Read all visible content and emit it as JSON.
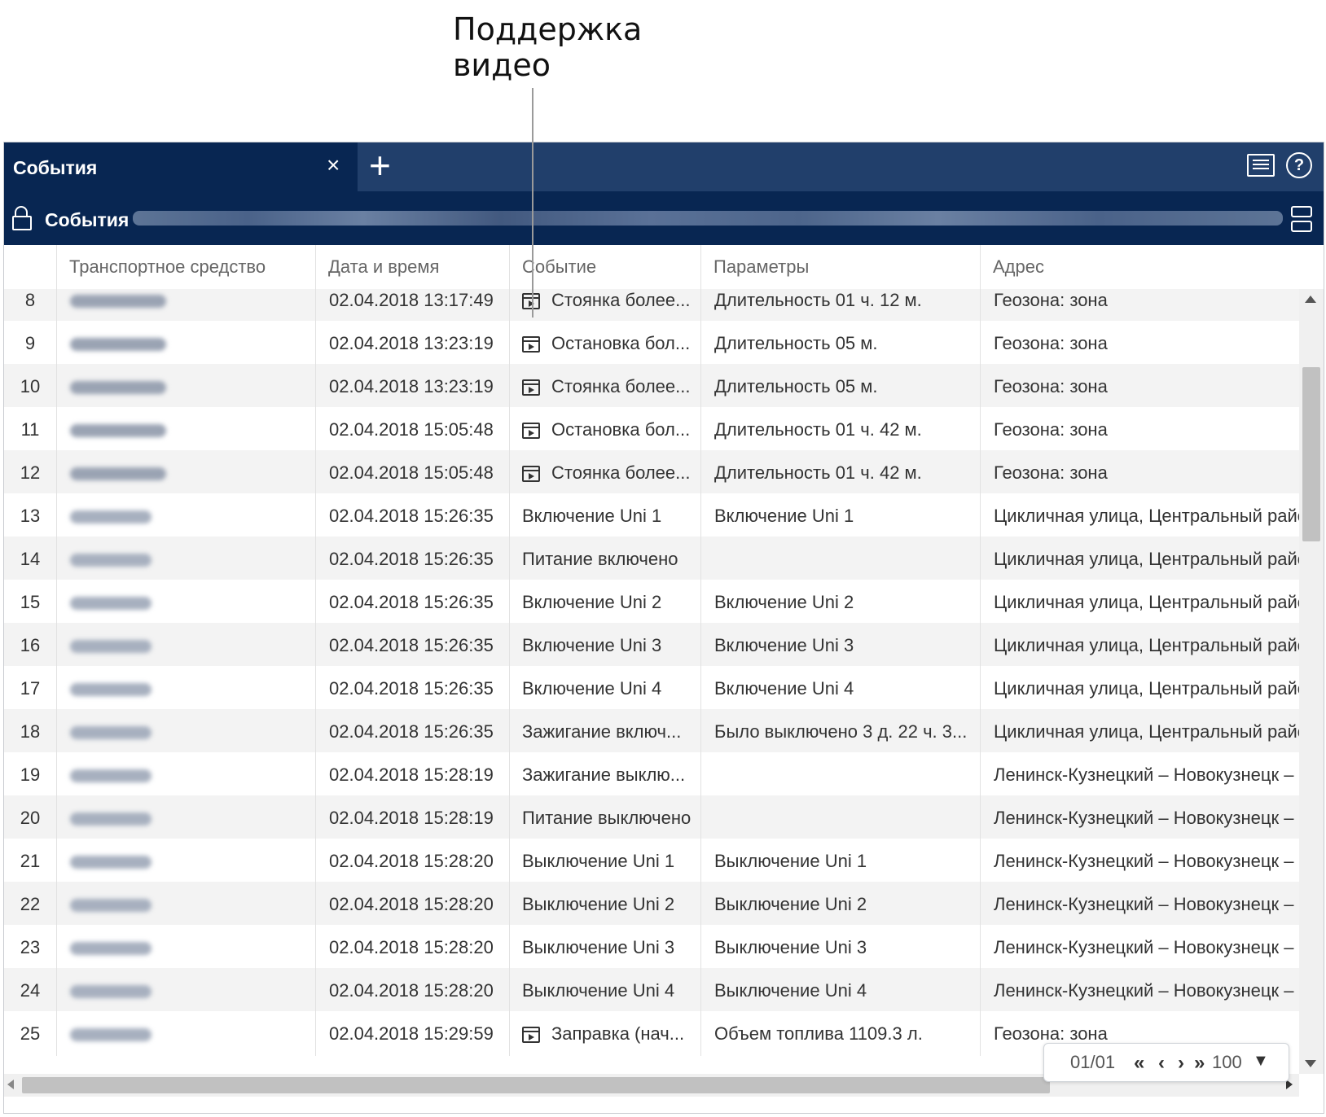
{
  "callout": {
    "line1": "Поддержка",
    "line2": "видео"
  },
  "tab": {
    "title": "События",
    "close": "×",
    "add": "+"
  },
  "icons": {
    "chat": "chat-icon",
    "help": "help-icon",
    "lock": "unlock-icon",
    "split": "split-view-icon",
    "video": "video-icon",
    "help_glyph": "?"
  },
  "subbar": {
    "title": "События"
  },
  "columns": {
    "vehicle": "Транспортное средство",
    "datetime": "Дата и время",
    "event": "Событие",
    "params": "Параметры",
    "address": "Адрес"
  },
  "rows": [
    {
      "num": "8",
      "date": "02.04.2018 13:17:49",
      "event": "Стоянка более...",
      "params": "Длительность 01 ч. 12 м.",
      "address": "Геозона: зона",
      "video": true
    },
    {
      "num": "9",
      "date": "02.04.2018 13:23:19",
      "event": "Остановка бол...",
      "params": "Длительность 05 м.",
      "address": "Геозона: зона",
      "video": true
    },
    {
      "num": "10",
      "date": "02.04.2018 13:23:19",
      "event": "Стоянка более...",
      "params": "Длительность 05 м.",
      "address": "Геозона: зона",
      "video": true
    },
    {
      "num": "11",
      "date": "02.04.2018 15:05:48",
      "event": "Остановка бол...",
      "params": "Длительность 01 ч. 42 м.",
      "address": "Геозона: зона",
      "video": true
    },
    {
      "num": "12",
      "date": "02.04.2018 15:05:48",
      "event": "Стоянка более...",
      "params": "Длительность 01 ч. 42 м.",
      "address": "Геозона: зона",
      "video": true
    },
    {
      "num": "13",
      "date": "02.04.2018 15:26:35",
      "event": "Включение Uni 1",
      "params": "Включение Uni 1",
      "address": "Цикличная улица, Центральный райо",
      "video": false
    },
    {
      "num": "14",
      "date": "02.04.2018 15:26:35",
      "event": "Питание включено",
      "params": "",
      "address": "Цикличная улица, Центральный райо",
      "video": false
    },
    {
      "num": "15",
      "date": "02.04.2018 15:26:35",
      "event": "Включение Uni 2",
      "params": "Включение Uni 2",
      "address": "Цикличная улица, Центральный райо",
      "video": false
    },
    {
      "num": "16",
      "date": "02.04.2018 15:26:35",
      "event": "Включение Uni 3",
      "params": "Включение Uni 3",
      "address": "Цикличная улица, Центральный райо",
      "video": false
    },
    {
      "num": "17",
      "date": "02.04.2018 15:26:35",
      "event": "Включение Uni 4",
      "params": "Включение Uni 4",
      "address": "Цикличная улица, Центральный райо",
      "video": false
    },
    {
      "num": "18",
      "date": "02.04.2018 15:26:35",
      "event": "Зажигание включ...",
      "params": "Было выключено 3 д. 22 ч. 3...",
      "address": "Цикличная улица, Центральный райо",
      "video": false
    },
    {
      "num": "19",
      "date": "02.04.2018 15:28:19",
      "event": "Зажигание выклю...",
      "params": "",
      "address": "Ленинск-Кузнецкий – Новокузнецк –",
      "video": false
    },
    {
      "num": "20",
      "date": "02.04.2018 15:28:19",
      "event": "Питание выключено",
      "params": "",
      "address": "Ленинск-Кузнецкий – Новокузнецк –",
      "video": false
    },
    {
      "num": "21",
      "date": "02.04.2018 15:28:20",
      "event": "Выключение Uni 1",
      "params": "Выключение Uni 1",
      "address": "Ленинск-Кузнецкий – Новокузнецк –",
      "video": false
    },
    {
      "num": "22",
      "date": "02.04.2018 15:28:20",
      "event": "Выключение Uni 2",
      "params": "Выключение Uni 2",
      "address": "Ленинск-Кузнецкий – Новокузнецк –",
      "video": false
    },
    {
      "num": "23",
      "date": "02.04.2018 15:28:20",
      "event": "Выключение Uni 3",
      "params": "Выключение Uni 3",
      "address": "Ленинск-Кузнецкий – Новокузнецк –",
      "video": false
    },
    {
      "num": "24",
      "date": "02.04.2018 15:28:20",
      "event": "Выключение Uni 4",
      "params": "Выключение Uni 4",
      "address": "Ленинск-Кузнецкий – Новокузнецк –",
      "video": false
    },
    {
      "num": "25",
      "date": "02.04.2018 15:29:59",
      "event": "Заправка (нач...",
      "params": "Объем топлива 1109.3 л.",
      "address": "Геозона: зона",
      "video": true
    }
  ],
  "pager": {
    "page": "01/01",
    "first": "«",
    "prev": "‹",
    "next": "›",
    "last": "»",
    "size": "100",
    "dropdown": "▼"
  }
}
